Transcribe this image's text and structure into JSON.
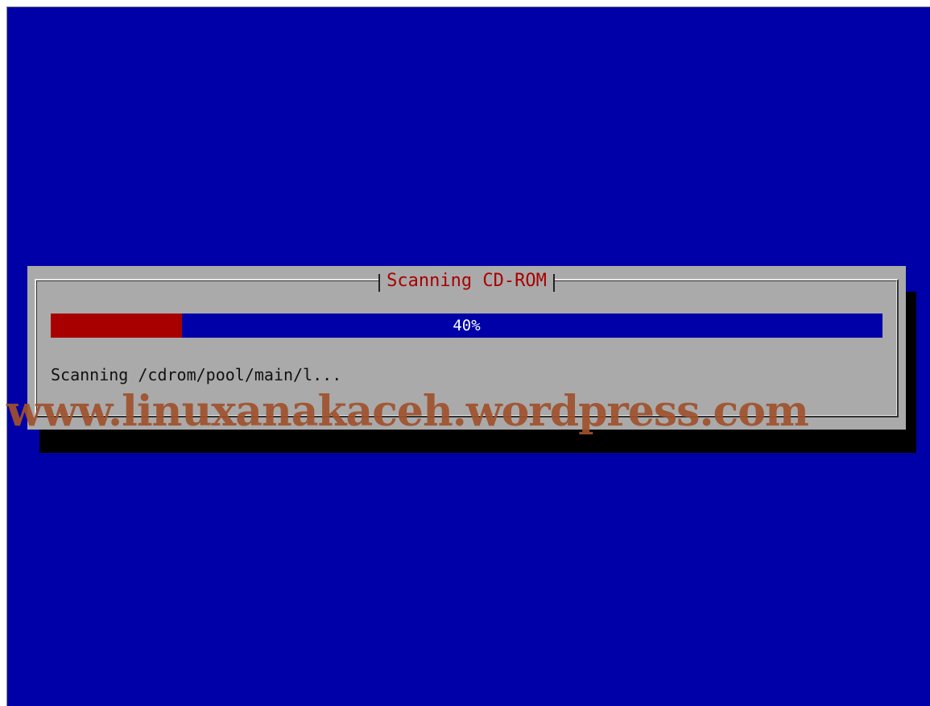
{
  "dialog": {
    "title": "Scanning CD-ROM",
    "progress": {
      "percent": 40,
      "label": "40%"
    },
    "status_text": "Scanning /cdrom/pool/main/l..."
  },
  "watermark": {
    "text": "www.linuxanakaceh.wordpress.com"
  },
  "colors": {
    "background": "#0000a8",
    "dialog": "#aaaaaa",
    "progress_fill": "#a80000",
    "title_text": "#a80000",
    "watermark": "#a0522d"
  }
}
